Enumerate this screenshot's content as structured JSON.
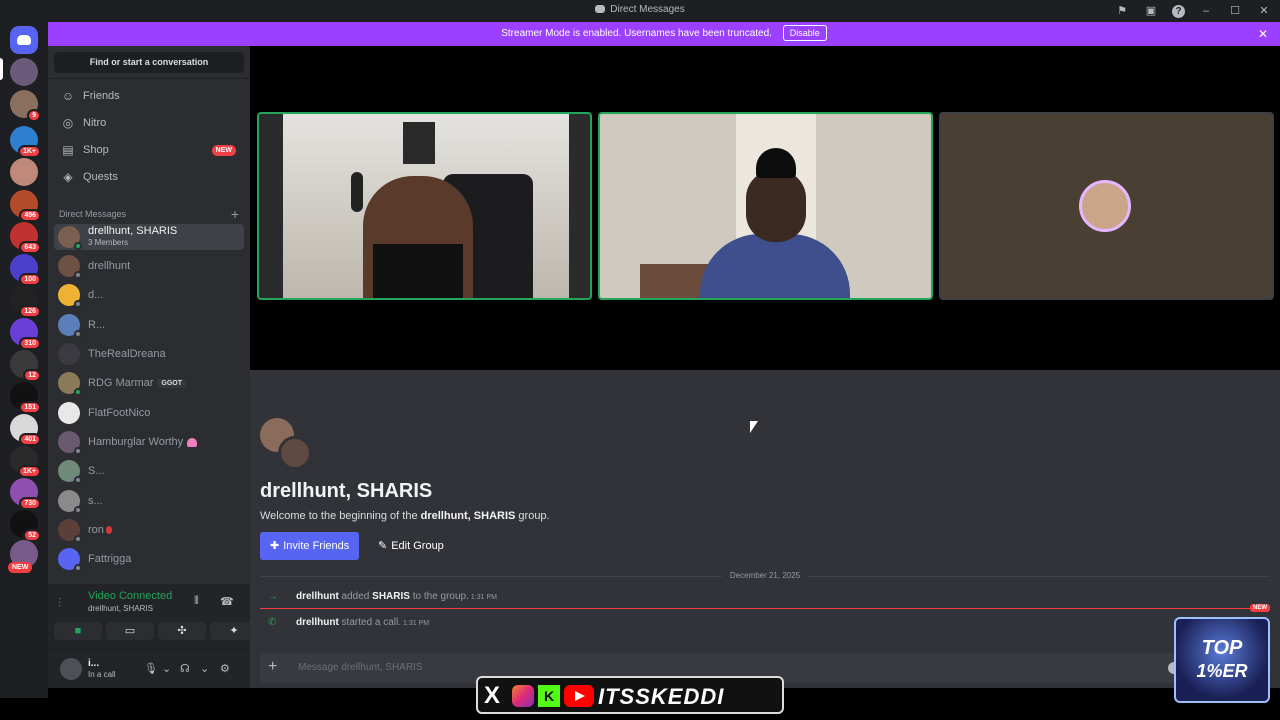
{
  "window": {
    "title": "Direct Messages"
  },
  "banner": {
    "text": "Streamer Mode is enabled. Usernames have been truncated.",
    "disable_label": "Disable"
  },
  "rail": {
    "badges": [
      "9",
      "1K+",
      "496",
      "643",
      "100",
      "126",
      "310",
      "12",
      "151",
      "401",
      "1K+",
      "730",
      "52"
    ],
    "new_label": "NEW"
  },
  "sidebar": {
    "search_label": "Find or start a conversation",
    "nav": [
      {
        "label": "Friends",
        "icon": "friends-icon"
      },
      {
        "label": "Nitro",
        "icon": "nitro-icon"
      },
      {
        "label": "Shop",
        "icon": "shop-icon",
        "badge": "NEW"
      },
      {
        "label": "Quests",
        "icon": "quests-icon"
      }
    ],
    "dm_header": "Direct Messages",
    "dms": [
      {
        "name": "drellhunt, SHARIS",
        "sub": "3 Members"
      },
      {
        "name": "drellhunt"
      },
      {
        "name": "d..."
      },
      {
        "name": "R..."
      },
      {
        "name": "TheRealDreana"
      },
      {
        "name": "RDG Marmar",
        "tag": "GGOT"
      },
      {
        "name": "FlatFootNico"
      },
      {
        "name": "Hamburglar Worthy"
      },
      {
        "name": "S..."
      },
      {
        "name": "s..."
      },
      {
        "name": "ron"
      },
      {
        "name": "Fattrigga"
      }
    ]
  },
  "voice": {
    "status": "Video Connected",
    "channel": "drellhunt, SHARIS"
  },
  "user": {
    "name": "i...",
    "status": "In a call"
  },
  "chat": {
    "group_title": "drellhunt, SHARIS",
    "welcome_prefix": "Welcome to the beginning of the ",
    "welcome_name": "drellhunt, SHARIS",
    "welcome_suffix": " group.",
    "invite_label": "Invite Friends",
    "edit_label": "Edit Group",
    "date": "December 21, 2025",
    "messages": [
      {
        "actor": "drellhunt",
        "text1": " added ",
        "target": "SHARIS",
        "text2": " to the group.",
        "time": "1:31 PM"
      },
      {
        "actor": "drellhunt",
        "text1": " started a call.",
        "time": "1:31 PM"
      }
    ],
    "new_label": "NEW",
    "composer_placeholder": "Message drellhunt, SHARIS"
  },
  "overlay": {
    "brand_text": "ITSSKEDDI",
    "x_mark": "X",
    "kick_mark": "K",
    "badge_line1": "TOP",
    "badge_line2": "1%ER"
  },
  "colors": {
    "accent": "#5865f2",
    "banner": "#9b40ff",
    "online": "#23a55a",
    "danger": "#f23f43"
  }
}
